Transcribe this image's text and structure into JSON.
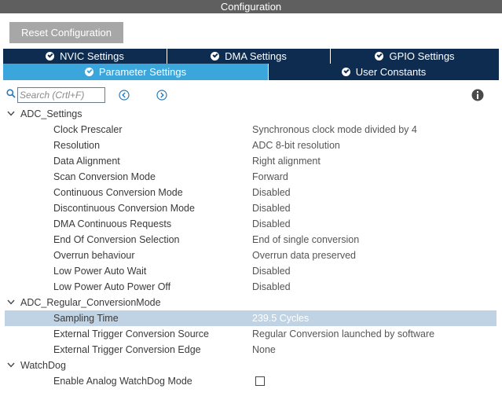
{
  "window": {
    "title": "Configuration"
  },
  "toolbar": {
    "reset_label": "Reset Configuration"
  },
  "tabs_row1": [
    {
      "label": "NVIC Settings",
      "active": false,
      "icon": "check-circle-icon"
    },
    {
      "label": "DMA Settings",
      "active": false,
      "icon": "check-circle-icon"
    },
    {
      "label": "GPIO Settings",
      "active": false,
      "icon": "check-circle-icon"
    }
  ],
  "tabs_row2": [
    {
      "label": "Parameter Settings",
      "active": true,
      "icon": "check-circle-icon"
    },
    {
      "label": "User Constants",
      "active": false,
      "icon": "check-circle-icon"
    }
  ],
  "search": {
    "placeholder": "Search (Crtl+F)",
    "value": ""
  },
  "colors": {
    "tab_dark": "#0d2c4f",
    "tab_active": "#3aa6db",
    "selected_row": "#c0d3e4",
    "title_bar": "#5f5f5f"
  },
  "groups": [
    {
      "label": "ADC_Settings",
      "params": [
        {
          "name": "Clock Prescaler",
          "value": "Synchronous clock mode divided by 4"
        },
        {
          "name": "Resolution",
          "value": "ADC 8-bit resolution"
        },
        {
          "name": "Data Alignment",
          "value": "Right alignment"
        },
        {
          "name": "Scan Conversion Mode",
          "value": "Forward"
        },
        {
          "name": "Continuous Conversion Mode",
          "value": "Disabled"
        },
        {
          "name": "Discontinuous Conversion Mode",
          "value": "Disabled"
        },
        {
          "name": "DMA Continuous Requests",
          "value": "Disabled"
        },
        {
          "name": "End Of Conversion Selection",
          "value": "End of single conversion"
        },
        {
          "name": "Overrun behaviour",
          "value": "Overrun data preserved"
        },
        {
          "name": "Low Power Auto Wait",
          "value": "Disabled"
        },
        {
          "name": "Low Power Auto Power Off",
          "value": "Disabled"
        }
      ]
    },
    {
      "label": "ADC_Regular_ConversionMode",
      "params": [
        {
          "name": "Sampling Time",
          "value": "239.5 Cycles",
          "selected": true
        },
        {
          "name": "External Trigger Conversion Source",
          "value": "Regular Conversion launched by software"
        },
        {
          "name": "External Trigger Conversion Edge",
          "value": "None"
        }
      ]
    },
    {
      "label": "WatchDog",
      "params": [
        {
          "name": "Enable Analog WatchDog Mode",
          "checkbox": true,
          "checked": false
        }
      ]
    }
  ]
}
